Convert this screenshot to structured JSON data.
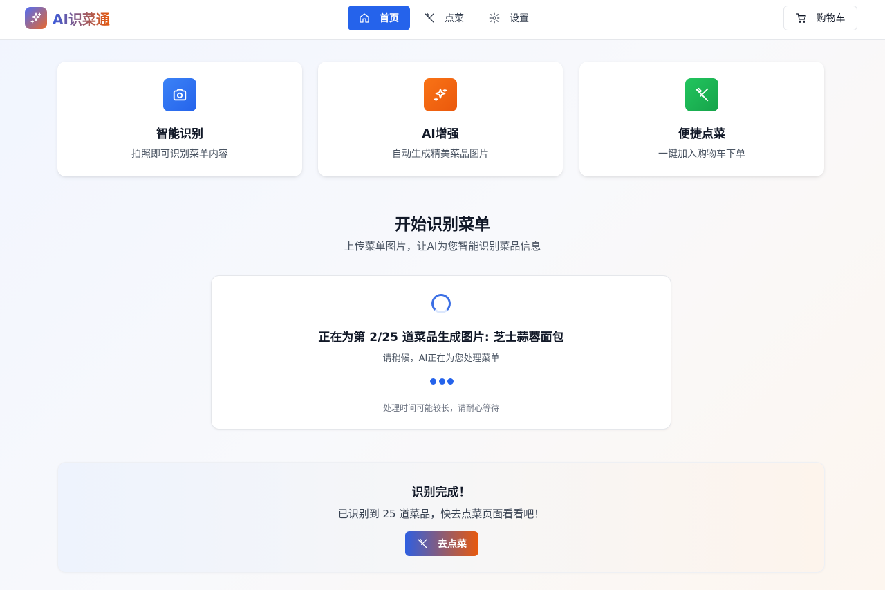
{
  "app": {
    "name": "AI识菜通",
    "logo_icon": "sparkles-icon",
    "accent_color": "#2563eb",
    "secondary_color": "#ea580c"
  },
  "nav": {
    "items": [
      {
        "label": "首页",
        "icon": "home-icon",
        "active": true
      },
      {
        "label": "点菜",
        "icon": "utensils-icon",
        "active": false
      },
      {
        "label": "设置",
        "icon": "gear-icon",
        "active": false
      }
    ],
    "cart_label": "购物车",
    "cart_icon": "cart-icon"
  },
  "features": [
    {
      "title": "智能识别",
      "desc": "拍照即可识别菜单内容",
      "icon": "camera-icon",
      "color": "#3b82f6"
    },
    {
      "title": "AI增强",
      "desc": "自动生成精美菜品图片",
      "icon": "sparkles-icon",
      "color": "#f97316"
    },
    {
      "title": "便捷点菜",
      "desc": "一键加入购物车下单",
      "icon": "utensils-icon",
      "color": "#22c55e"
    }
  ],
  "section": {
    "title": "开始识别菜单",
    "subtitle": "上传菜单图片，让AI为您智能识别菜品信息"
  },
  "processing": {
    "status": "正在为第 2/25 道菜品生成图片: 芝士蒜蓉面包",
    "subtitle": "请稍候，AI正在为您处理菜单",
    "note": "处理时间可能较长，请耐心等待",
    "current": 2,
    "total": 25
  },
  "complete": {
    "title": "识别完成！",
    "message": "已识别到 25 道菜品，快去点菜页面看看吧！",
    "button_label": "去点菜",
    "button_icon": "utensils-icon"
  }
}
